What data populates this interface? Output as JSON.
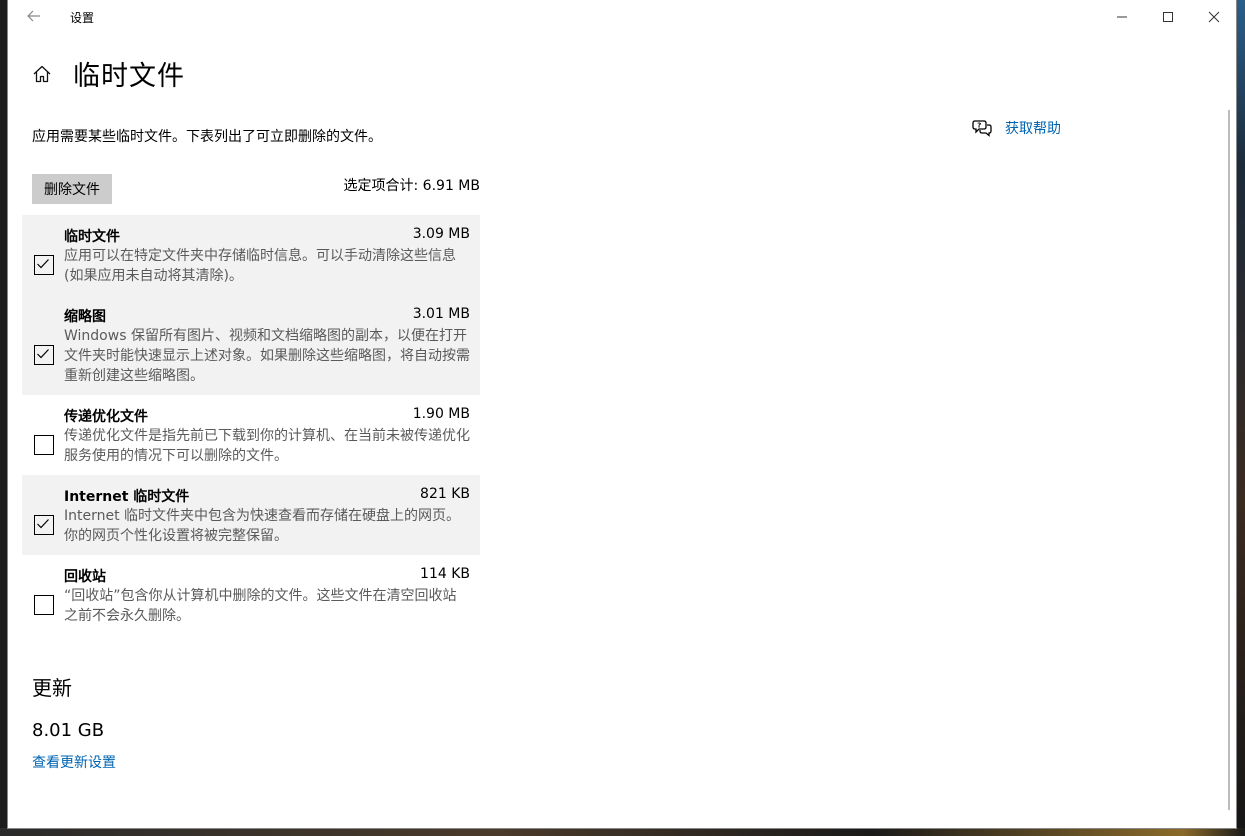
{
  "window": {
    "title": "设置"
  },
  "page": {
    "title": "临时文件",
    "intro": "应用需要某些临时文件。下表列出了可立即删除的文件。"
  },
  "help": {
    "label": "获取帮助"
  },
  "actions": {
    "delete_label": "删除文件",
    "total_label": "选定项合计: 6.91 MB"
  },
  "items": [
    {
      "name": "临时文件",
      "size": "3.09 MB",
      "checked": true,
      "description": "应用可以在特定文件夹中存储临时信息。可以手动清除这些信息(如果应用未自动将其清除)。"
    },
    {
      "name": "缩略图",
      "size": "3.01 MB",
      "checked": true,
      "description": "Windows 保留所有图片、视频和文档缩略图的副本，以便在打开文件夹时能快速显示上述对象。如果删除这些缩略图，将自动按需重新创建这些缩略图。"
    },
    {
      "name": "传递优化文件",
      "size": "1.90 MB",
      "checked": false,
      "description": "传递优化文件是指先前已下载到你的计算机、在当前未被传递优化服务使用的情况下可以删除的文件。"
    },
    {
      "name": "Internet 临时文件",
      "size": "821 KB",
      "checked": true,
      "description": "Internet 临时文件夹中包含为快速查看而存储在硬盘上的网页。你的网页个性化设置将被完整保留。"
    },
    {
      "name": "回收站",
      "size": "114 KB",
      "checked": false,
      "description": "“回收站”包含你从计算机中删除的文件。这些文件在清空回收站之前不会永久删除。"
    }
  ],
  "updates": {
    "heading": "更新",
    "size": "8.01 GB",
    "link": "查看更新设置"
  }
}
